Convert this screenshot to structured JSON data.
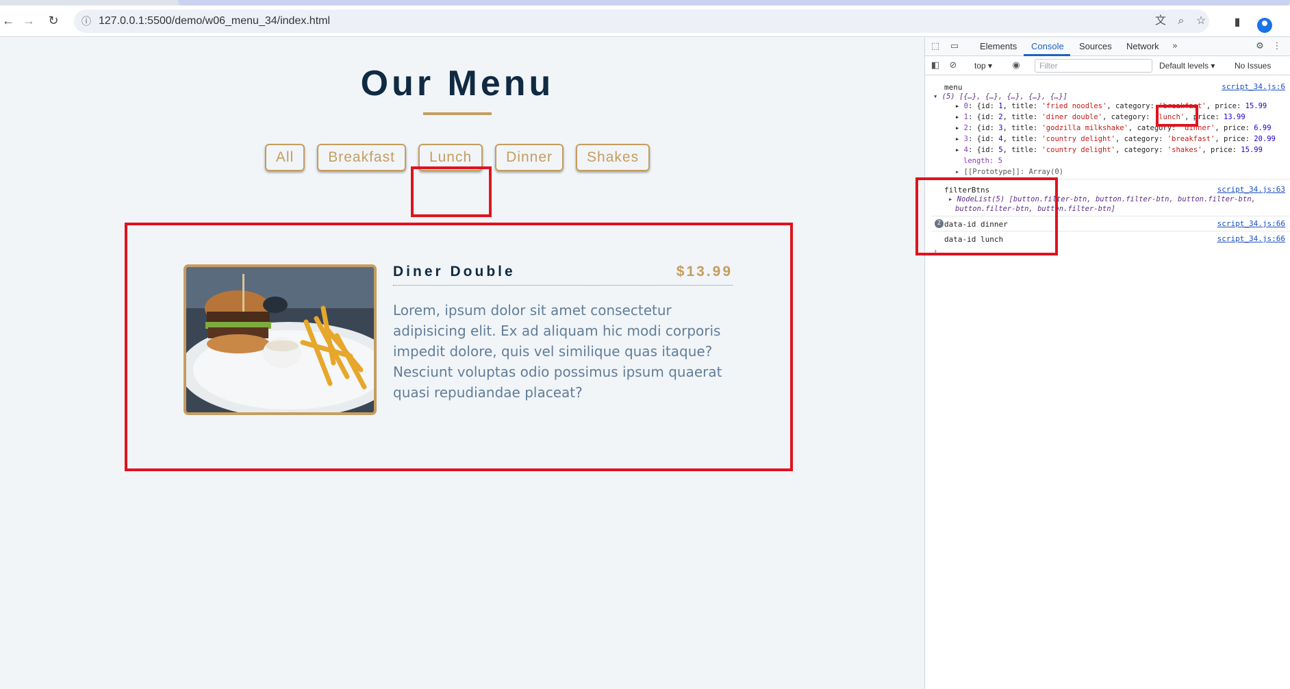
{
  "browser": {
    "url": "127.0.0.1:5500/demo/w06_menu_34/index.html"
  },
  "page": {
    "title": "Our Menu",
    "filters": [
      "All",
      "Breakfast",
      "Lunch",
      "Dinner",
      "Shakes"
    ],
    "item": {
      "title": "Diner Double",
      "price": "$13.99",
      "description": "Lorem, ipsum dolor sit amet consectetur adipisicing elit. Ex ad aliquam hic modi corporis impedit dolore, quis vel similique quas itaque? Nesciunt voluptas odio possimus ipsum quaerat quasi repudiandae placeat?"
    },
    "colors": {
      "accent": "#c59d5f",
      "heading": "#102a42",
      "text": "#617d98",
      "highlight": "#e0121f"
    }
  },
  "devtools": {
    "tabs": [
      "Elements",
      "Console",
      "Sources",
      "Network"
    ],
    "active_tab": "Console",
    "context": "top",
    "filter_placeholder": "Filter",
    "levels": "Default levels",
    "issues": "No Issues",
    "logs": {
      "menu_label": "menu",
      "menu_src": "script_34.js:6",
      "menu_summary": "(5) [{…}, {…}, {…}, {…}, {…}]",
      "menu_rows": [
        {
          "i": "0",
          "id": "1",
          "title": "'fried noodles'",
          "category": "'breakfast'",
          "price": "15.99"
        },
        {
          "i": "1",
          "id": "2",
          "title": "'diner double'",
          "category": "'lunch'",
          "price": "13.99"
        },
        {
          "i": "2",
          "id": "3",
          "title": "'godzilla milkshake'",
          "category": "'dinner'",
          "price": "6.99"
        },
        {
          "i": "3",
          "id": "4",
          "title": "'country delight'",
          "category": "'breakfast'",
          "price": "20.99"
        },
        {
          "i": "4",
          "id": "5",
          "title": "'country delight'",
          "category": "'shakes'",
          "price": "15.99"
        }
      ],
      "menu_length": "length: 5",
      "menu_proto": "[[Prototype]]: Array(0)",
      "filter_label": "filterBtns",
      "filter_src": "script_34.js:63",
      "filter_nodelist_1": "NodeList(5) [button.filter-btn, button.filter-btn, button.filter-btn,",
      "filter_nodelist_2": "button.filter-btn, button.filter-btn]",
      "dataid_count": "2",
      "dataid_dinner": "data-id dinner",
      "dataid_dinner_src": "script_34.js:66",
      "dataid_lunch": "data-id lunch",
      "dataid_lunch_src": "script_34.js:66"
    }
  }
}
